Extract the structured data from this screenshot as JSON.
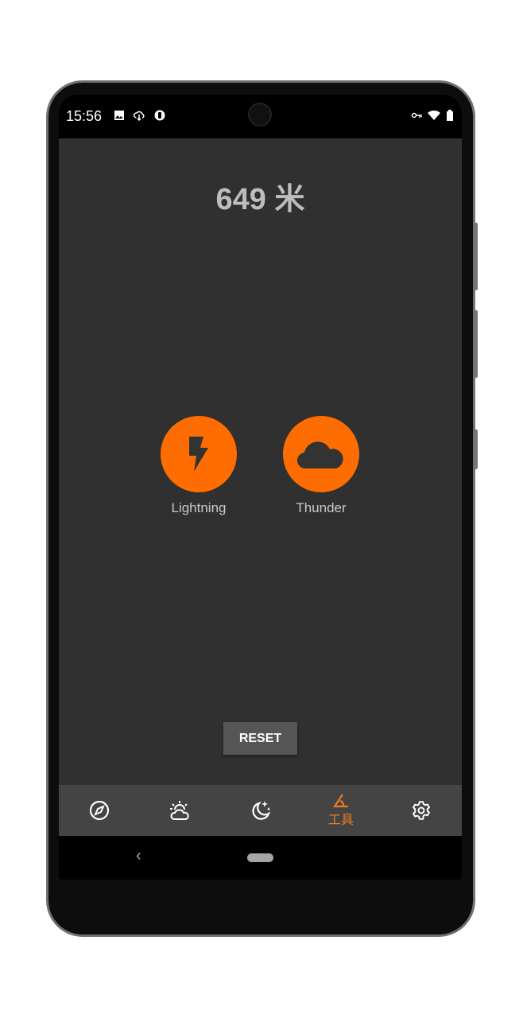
{
  "status_bar": {
    "time": "15:56",
    "left_icons": [
      "image-icon",
      "cloud-download-icon",
      "data-saver-icon"
    ],
    "right_icons": [
      "vpn-key-icon",
      "wifi-icon",
      "battery-icon"
    ]
  },
  "main": {
    "distance": "649 米",
    "actions": [
      {
        "label": "Lightning",
        "icon": "lightning-bolt-icon"
      },
      {
        "label": "Thunder",
        "icon": "cloud-icon"
      }
    ],
    "reset_label": "RESET"
  },
  "bottom_nav": {
    "items": [
      {
        "icon": "compass-icon",
        "label": ""
      },
      {
        "icon": "weather-icon",
        "label": ""
      },
      {
        "icon": "moon-stars-icon",
        "label": ""
      },
      {
        "icon": "angle-tool-icon",
        "label": "工具",
        "active": true
      },
      {
        "icon": "gear-icon",
        "label": ""
      }
    ]
  },
  "colors": {
    "accent": "#ff6d00",
    "background": "#303030",
    "nav": "#444444"
  }
}
